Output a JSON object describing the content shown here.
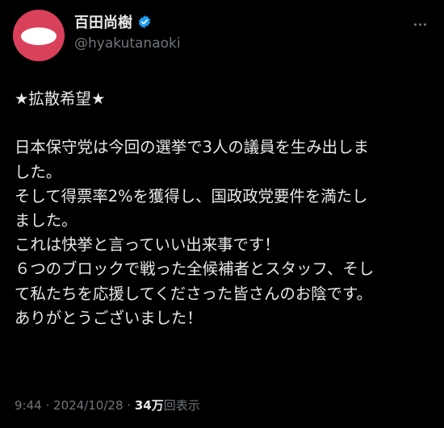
{
  "author": {
    "display_name": "百田尚樹",
    "handle": "@hyakutanaoki",
    "avatar_color": "#d9415a",
    "verified_color": "#1d9bf0"
  },
  "post": {
    "lines": [
      "★拡散希望★",
      "",
      "日本保守党は今回の選挙で3人の議員を生み出しま",
      "した。",
      "そして得票率2%を獲得し、国政政党要件を満たし",
      "ました。",
      "これは快挙と言っていい出来事です！",
      "６つのブロックで戦った全候補者とスタッフ、そし",
      "て私たちを応援してくださった皆さんのお陰です。",
      "ありがとうございました！"
    ]
  },
  "meta": {
    "time": "9:44",
    "separator": "·",
    "date": "2024/10/28",
    "views_count": "34万",
    "views_label": "回表示"
  },
  "colors": {
    "background": "#000000",
    "text": "#e7e9ea",
    "secondary": "#71767b"
  }
}
